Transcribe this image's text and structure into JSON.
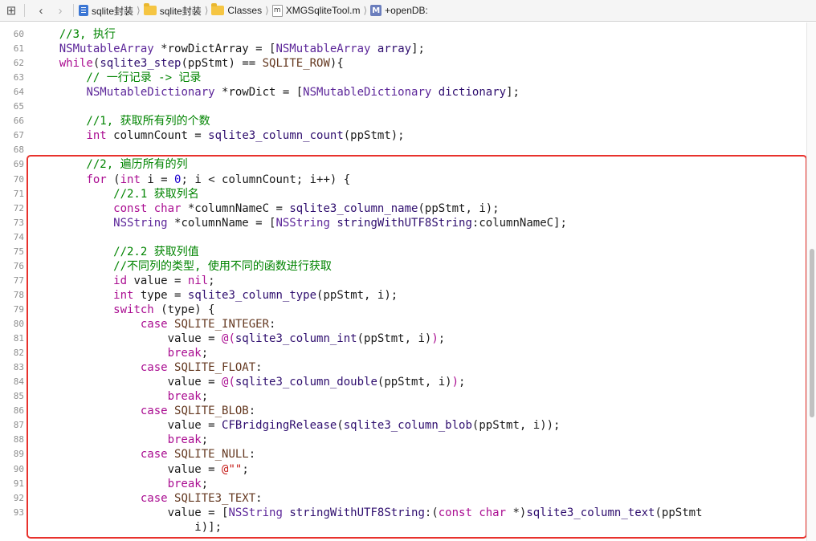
{
  "breadcrumbs": [
    {
      "icon": "project-icon",
      "label": "sqlite封装"
    },
    {
      "icon": "folder-icon",
      "label": "sqlite封装"
    },
    {
      "icon": "folder-icon",
      "label": "Classes"
    },
    {
      "icon": "objc-file-icon",
      "label": "XMGSqliteTool.m"
    },
    {
      "icon": "method-icon",
      "label": "+openDB:"
    }
  ],
  "file_icon_letter": "m",
  "method_icon_letter": "M",
  "colors": {
    "comment": "#008400",
    "keyword": "#aa0d91",
    "type": "#5c2699",
    "function": "#2e0d6e",
    "number": "#1c00cf",
    "string": "#c41a16",
    "highlight_box": "#e8322d"
  },
  "code_lines": [
    {
      "num": "60",
      "tokens": [
        [
          "cm",
          "    //3, 执行"
        ]
      ]
    },
    {
      "num": "61",
      "tokens": [
        [
          "pl",
          "    "
        ],
        [
          "type",
          "NSMutableArray"
        ],
        [
          "pl",
          " *rowDictArray = ["
        ],
        [
          "type",
          "NSMutableArray"
        ],
        [
          "pl",
          " "
        ],
        [
          "fn",
          "array"
        ],
        [
          "pl",
          "];"
        ]
      ]
    },
    {
      "num": "62",
      "tokens": [
        [
          "pl",
          "    "
        ],
        [
          "kw",
          "while"
        ],
        [
          "pl",
          "("
        ],
        [
          "fn",
          "sqlite3_step"
        ],
        [
          "pl",
          "(ppStmt) == "
        ],
        [
          "macro",
          "SQLITE_ROW"
        ],
        [
          "pl",
          "){"
        ]
      ]
    },
    {
      "num": "63",
      "tokens": [
        [
          "cm",
          "        // 一行记录 -> 记录"
        ]
      ]
    },
    {
      "num": "64",
      "tokens": [
        [
          "pl",
          "        "
        ],
        [
          "type",
          "NSMutableDictionary"
        ],
        [
          "pl",
          " *rowDict = ["
        ],
        [
          "type",
          "NSMutableDictionary"
        ],
        [
          "pl",
          " "
        ],
        [
          "fn",
          "dictionary"
        ],
        [
          "pl",
          "];"
        ]
      ]
    },
    {
      "num": "65",
      "tokens": []
    },
    {
      "num": "66",
      "tokens": [
        [
          "cm",
          "        //1, 获取所有列的个数"
        ]
      ]
    },
    {
      "num": "67",
      "tokens": [
        [
          "pl",
          "        "
        ],
        [
          "kw",
          "int"
        ],
        [
          "pl",
          " columnCount = "
        ],
        [
          "fn",
          "sqlite3_column_count"
        ],
        [
          "pl",
          "(ppStmt);"
        ]
      ]
    },
    {
      "num": "68",
      "tokens": []
    },
    {
      "num": "69",
      "tokens": [
        [
          "cm",
          "        //2, 遍历所有的列"
        ]
      ]
    },
    {
      "num": "70",
      "tokens": [
        [
          "pl",
          "        "
        ],
        [
          "kw",
          "for"
        ],
        [
          "pl",
          " ("
        ],
        [
          "kw",
          "int"
        ],
        [
          "pl",
          " i = "
        ],
        [
          "num",
          "0"
        ],
        [
          "pl",
          "; i < columnCount; i++) {"
        ]
      ]
    },
    {
      "num": "71",
      "tokens": [
        [
          "cm",
          "            //2.1 获取列名"
        ]
      ]
    },
    {
      "num": "72",
      "tokens": [
        [
          "pl",
          "            "
        ],
        [
          "kw",
          "const char"
        ],
        [
          "pl",
          " *columnNameC = "
        ],
        [
          "fn",
          "sqlite3_column_name"
        ],
        [
          "pl",
          "(ppStmt, i);"
        ]
      ]
    },
    {
      "num": "73",
      "tokens": [
        [
          "pl",
          "            "
        ],
        [
          "type",
          "NSString"
        ],
        [
          "pl",
          " *columnName = ["
        ],
        [
          "type",
          "NSString"
        ],
        [
          "pl",
          " "
        ],
        [
          "fn",
          "stringWithUTF8String"
        ],
        [
          "pl",
          ":columnNameC];"
        ]
      ]
    },
    {
      "num": "74",
      "tokens": []
    },
    {
      "num": "75",
      "tokens": [
        [
          "cm",
          "            //2.2 获取列值"
        ]
      ]
    },
    {
      "num": "76",
      "tokens": [
        [
          "cm",
          "            //不同列的类型, 使用不同的函数进行获取"
        ]
      ]
    },
    {
      "num": "77",
      "tokens": [
        [
          "pl",
          "            "
        ],
        [
          "kw",
          "id"
        ],
        [
          "pl",
          " value = "
        ],
        [
          "kw",
          "nil"
        ],
        [
          "pl",
          ";"
        ]
      ]
    },
    {
      "num": "78",
      "tokens": [
        [
          "pl",
          "            "
        ],
        [
          "kw",
          "int"
        ],
        [
          "pl",
          " type = "
        ],
        [
          "fn",
          "sqlite3_column_type"
        ],
        [
          "pl",
          "(ppStmt, i);"
        ]
      ]
    },
    {
      "num": "79",
      "tokens": [
        [
          "pl",
          "            "
        ],
        [
          "kw",
          "switch"
        ],
        [
          "pl",
          " (type) {"
        ]
      ]
    },
    {
      "num": "80",
      "tokens": [
        [
          "pl",
          "                "
        ],
        [
          "kw",
          "case"
        ],
        [
          "pl",
          " "
        ],
        [
          "macro",
          "SQLITE_INTEGER"
        ],
        [
          "pl",
          ":"
        ]
      ]
    },
    {
      "num": "81",
      "tokens": [
        [
          "pl",
          "                    value = "
        ],
        [
          "kw",
          "@("
        ],
        [
          "fn",
          "sqlite3_column_int"
        ],
        [
          "pl",
          "(ppStmt, i)"
        ],
        [
          "kw",
          ")"
        ],
        [
          "pl",
          ";"
        ]
      ]
    },
    {
      "num": "82",
      "tokens": [
        [
          "pl",
          "                    "
        ],
        [
          "kw",
          "break"
        ],
        [
          "pl",
          ";"
        ]
      ]
    },
    {
      "num": "83",
      "tokens": [
        [
          "pl",
          "                "
        ],
        [
          "kw",
          "case"
        ],
        [
          "pl",
          " "
        ],
        [
          "macro",
          "SQLITE_FLOAT"
        ],
        [
          "pl",
          ":"
        ]
      ]
    },
    {
      "num": "84",
      "tokens": [
        [
          "pl",
          "                    value = "
        ],
        [
          "kw",
          "@("
        ],
        [
          "fn",
          "sqlite3_column_double"
        ],
        [
          "pl",
          "(ppStmt, i)"
        ],
        [
          "kw",
          ")"
        ],
        [
          "pl",
          ";"
        ]
      ]
    },
    {
      "num": "85",
      "tokens": [
        [
          "pl",
          "                    "
        ],
        [
          "kw",
          "break"
        ],
        [
          "pl",
          ";"
        ]
      ]
    },
    {
      "num": "86",
      "tokens": [
        [
          "pl",
          "                "
        ],
        [
          "kw",
          "case"
        ],
        [
          "pl",
          " "
        ],
        [
          "macro",
          "SQLITE_BLOB"
        ],
        [
          "pl",
          ":"
        ]
      ]
    },
    {
      "num": "87",
      "tokens": [
        [
          "pl",
          "                    value = "
        ],
        [
          "fn",
          "CFBridgingRelease"
        ],
        [
          "pl",
          "("
        ],
        [
          "fn",
          "sqlite3_column_blob"
        ],
        [
          "pl",
          "(ppStmt, i));"
        ]
      ]
    },
    {
      "num": "88",
      "tokens": [
        [
          "pl",
          "                    "
        ],
        [
          "kw",
          "break"
        ],
        [
          "pl",
          ";"
        ]
      ]
    },
    {
      "num": "89",
      "tokens": [
        [
          "pl",
          "                "
        ],
        [
          "kw",
          "case"
        ],
        [
          "pl",
          " "
        ],
        [
          "macro",
          "SQLITE_NULL"
        ],
        [
          "pl",
          ":"
        ]
      ]
    },
    {
      "num": "90",
      "tokens": [
        [
          "pl",
          "                    value = "
        ],
        [
          "str",
          "@\"\""
        ],
        [
          "pl",
          ";"
        ]
      ]
    },
    {
      "num": "91",
      "tokens": [
        [
          "pl",
          "                    "
        ],
        [
          "kw",
          "break"
        ],
        [
          "pl",
          ";"
        ]
      ]
    },
    {
      "num": "92",
      "tokens": [
        [
          "pl",
          "                "
        ],
        [
          "kw",
          "case"
        ],
        [
          "pl",
          " "
        ],
        [
          "macro",
          "SQLITE3_TEXT"
        ],
        [
          "pl",
          ":"
        ]
      ]
    },
    {
      "num": "93",
      "tokens": [
        [
          "pl",
          "                    value = ["
        ],
        [
          "type",
          "NSString"
        ],
        [
          "pl",
          " "
        ],
        [
          "fn",
          "stringWithUTF8String"
        ],
        [
          "pl",
          ":("
        ],
        [
          "kw",
          "const char"
        ],
        [
          "pl",
          " *)"
        ],
        [
          "fn",
          "sqlite3_column_text"
        ],
        [
          "pl",
          "(ppStmt"
        ]
      ]
    },
    {
      "num": "",
      "tokens": [
        [
          "pl",
          "                        i)];"
        ]
      ]
    }
  ]
}
